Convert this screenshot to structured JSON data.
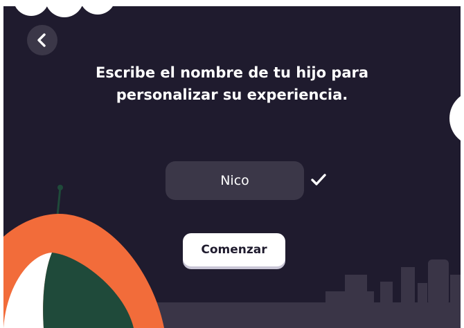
{
  "header": {
    "back_icon": "chevron-left-icon"
  },
  "prompt": {
    "line1": "Escribe el nombre de tu hijo para",
    "line2": "personalizar su experiencia."
  },
  "name_input": {
    "value": "Nico",
    "confirm_icon": "checkmark-icon"
  },
  "start_button": {
    "label": "Comenzar"
  },
  "colors": {
    "background": "#1f1b2e",
    "field": "#3b3748",
    "accent_orange": "#f26c3a",
    "accent_green": "#1f4a3a",
    "skyline": "#3a3547"
  }
}
